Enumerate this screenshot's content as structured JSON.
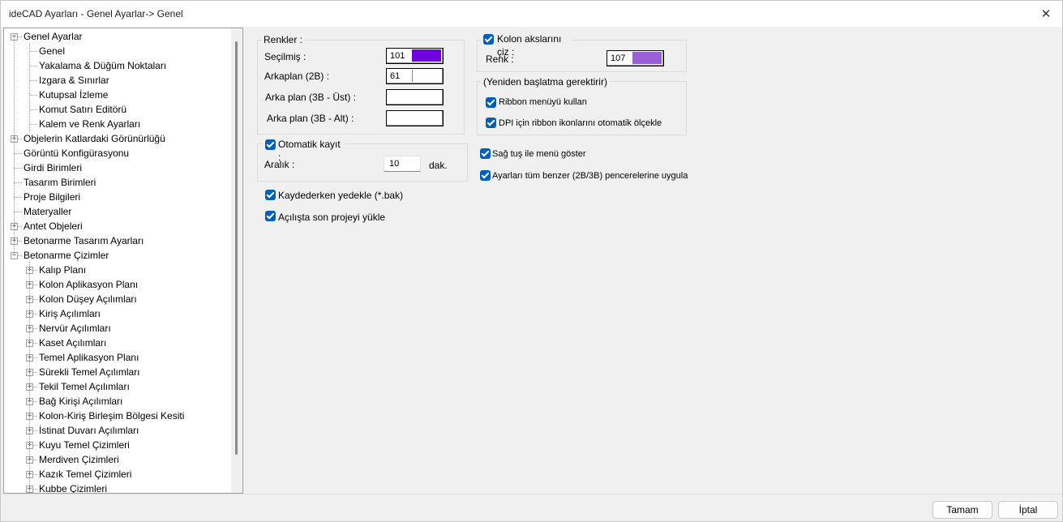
{
  "window": {
    "title": "ideCAD Ayarları - Genel Ayarlar-> Genel",
    "close_glyph": "✕"
  },
  "tree": {
    "items": [
      {
        "label": "Genel Ayarlar",
        "level": 0,
        "expander": "−"
      },
      {
        "label": "Genel",
        "level": 1,
        "expander": ""
      },
      {
        "label": "Yakalama & Düğüm Noktaları",
        "level": 1,
        "expander": ""
      },
      {
        "label": "Izgara & Sınırlar",
        "level": 1,
        "expander": ""
      },
      {
        "label": "Kutupsal İzleme",
        "level": 1,
        "expander": ""
      },
      {
        "label": "Komut Satırı Editörü",
        "level": 1,
        "expander": ""
      },
      {
        "label": "Kalem ve Renk Ayarları",
        "level": 1,
        "expander": ""
      },
      {
        "label": "Objelerin Katlardaki Görünürlüğü",
        "level": 0,
        "expander": "+"
      },
      {
        "label": "Görüntü Konfigürasyonu",
        "level": 0,
        "expander": ""
      },
      {
        "label": "Girdi Birimleri",
        "level": 0,
        "expander": ""
      },
      {
        "label": "Tasarım Birimleri",
        "level": 0,
        "expander": ""
      },
      {
        "label": "Proje Bilgileri",
        "level": 0,
        "expander": ""
      },
      {
        "label": "Materyaller",
        "level": 0,
        "expander": ""
      },
      {
        "label": "Antet Objeleri",
        "level": 0,
        "expander": "+"
      },
      {
        "label": "Betonarme Tasarım Ayarları",
        "level": 0,
        "expander": "+"
      },
      {
        "label": "Betonarme Çizimler",
        "level": 0,
        "expander": "−"
      },
      {
        "label": "Kalıp Planı",
        "level": 1,
        "expander": "+"
      },
      {
        "label": "Kolon Aplikasyon Planı",
        "level": 1,
        "expander": "+"
      },
      {
        "label": "Kolon Düşey Açılımları",
        "level": 1,
        "expander": "+"
      },
      {
        "label": "Kiriş Açılımları",
        "level": 1,
        "expander": "+"
      },
      {
        "label": "Nervür Açılımları",
        "level": 1,
        "expander": "+"
      },
      {
        "label": "Kaset Açılımları",
        "level": 1,
        "expander": "+"
      },
      {
        "label": "Temel Aplikasyon Planı",
        "level": 1,
        "expander": "+"
      },
      {
        "label": "Sürekli Temel Açılımları",
        "level": 1,
        "expander": "+"
      },
      {
        "label": "Tekil Temel Açılımları",
        "level": 1,
        "expander": "+"
      },
      {
        "label": "Bağ Kirişi Açılımları",
        "level": 1,
        "expander": "+"
      },
      {
        "label": "Kolon-Kiriş Birleşim Bölgesi Kesiti",
        "level": 1,
        "expander": "+"
      },
      {
        "label": "İstinat Duvarı Açılımları",
        "level": 1,
        "expander": "+"
      },
      {
        "label": "Kuyu Temel Çizimleri",
        "level": 1,
        "expander": "+"
      },
      {
        "label": "Merdiven Çizimleri",
        "level": 1,
        "expander": "+"
      },
      {
        "label": "Kazık Temel Çizimleri",
        "level": 1,
        "expander": "+"
      },
      {
        "label": "Kubbe Çizimleri",
        "level": 1,
        "expander": "+"
      }
    ]
  },
  "renkler": {
    "title": "Renkler :",
    "secilmis_label": "Seçilmiş :",
    "secilmis_value": "101",
    "secilmis_color": "#7000e0",
    "arkaplan_2b_label": "Arkaplan (2B) :",
    "arkaplan_2b_value": "61",
    "arkaplan_2b_color": "#ffffff",
    "arkaplan_3b_ust_label": "Arka plan (3B - Üst) :",
    "arkaplan_3b_alt_label": "Arka plan (3B - Alt) :"
  },
  "otomatik_kayit": {
    "title": "Otomatik kayıt :",
    "checked": true,
    "aralik_label": "Aralık :",
    "aralik_value": "10",
    "unit": "dak."
  },
  "checkboxes_left": {
    "kaydederken": "Kaydederken yedekle (*.bak)",
    "acilista": "Açılışta son projeyi yükle"
  },
  "kolon_akslari": {
    "title": "Kolon akslarını çiz :",
    "checked": true,
    "renk_label": "Renk :",
    "renk_value": "107",
    "renk_color": "#9a5fd6"
  },
  "yeniden": {
    "title": "(Yeniden başlatma gerektirir)",
    "ribbon": "Ribbon menüyü kullan",
    "dpi": "DPI için ribbon ikonlarını otomatik ölçekle"
  },
  "checkboxes_right": {
    "sag_tus": "Sağ tuş ile menü göster",
    "ayarlari": "Ayarları tüm benzer (2B/3B) pencerelerine uygula"
  },
  "footer": {
    "ok": "Tamam",
    "cancel": "İptal"
  }
}
